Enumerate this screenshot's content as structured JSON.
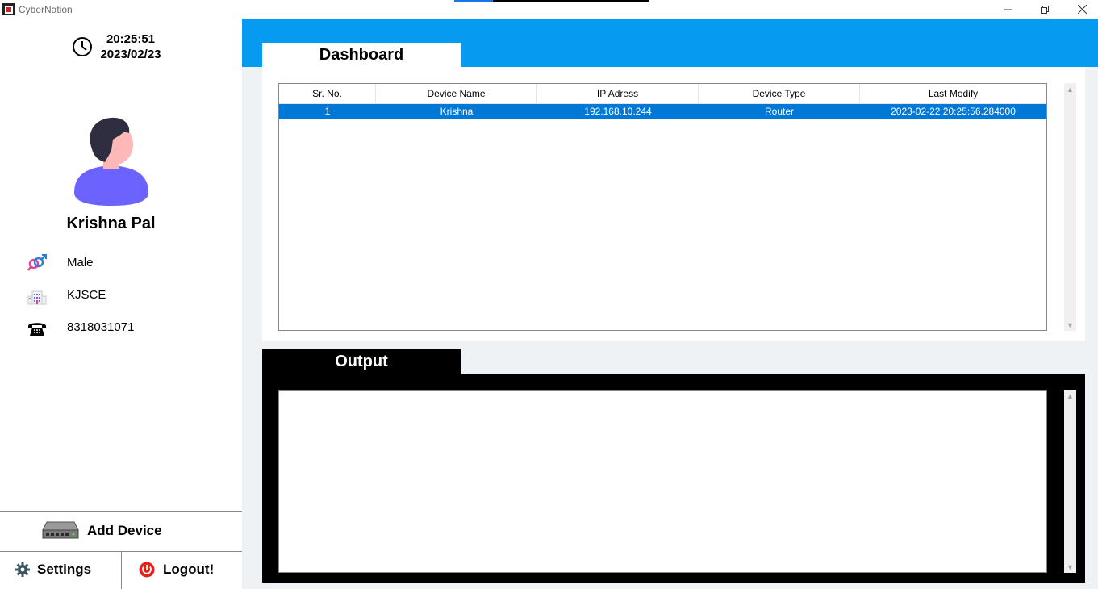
{
  "window": {
    "title": "CyberNation",
    "controls": [
      "minimize",
      "restore",
      "close"
    ]
  },
  "sidebar": {
    "clock": {
      "time": "20:25:51",
      "date": "2023/02/23"
    },
    "user": {
      "name": "Krishna Pal",
      "gender": "Male",
      "institute": "KJSCE",
      "phone": "8318031071"
    },
    "add_device_label": "Add Device",
    "settings_label": "Settings",
    "logout_label": "Logout!"
  },
  "tabs": {
    "dashboard": "Dashboard",
    "output": "Output"
  },
  "table": {
    "columns": [
      "Sr. No.",
      "Device Name",
      "IP Adress",
      "Device Type",
      "Last Modify"
    ],
    "rows": [
      [
        "1",
        "Krishna",
        "192.168.10.244",
        "Router",
        "2023-02-22 20:25:56.284000"
      ]
    ]
  },
  "output": {
    "text": ""
  },
  "colors": {
    "header_blue": "#069bf0",
    "selection_blue": "#0078d7",
    "main_bg": "#eef2f5",
    "avatar_shirt": "#6c63ff",
    "avatar_hair": "#2f2e41",
    "avatar_skin": "#ffb8b8",
    "logout_red": "#e2231a"
  }
}
